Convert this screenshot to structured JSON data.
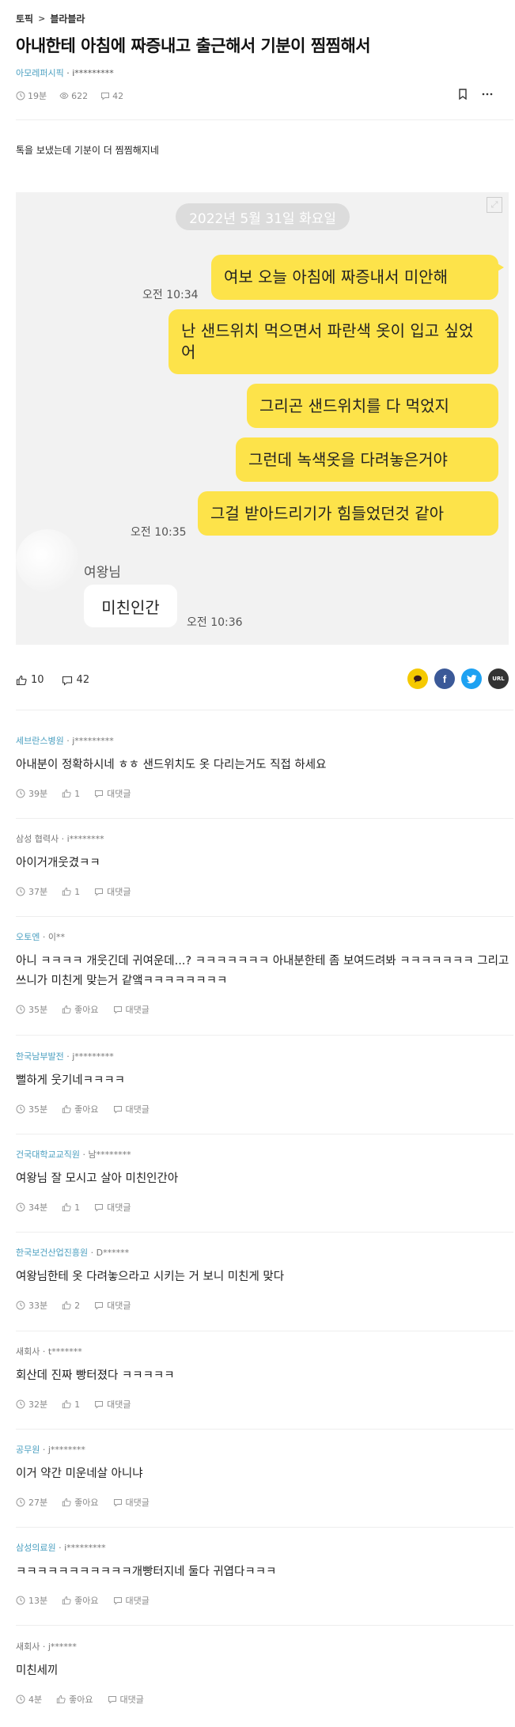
{
  "breadcrumb": {
    "section": "토픽",
    "separator": ">",
    "board": "블라블라"
  },
  "post": {
    "title": "아내한테 아침에 짜증내고 출근해서 기분이 찜찜해서",
    "company": "아모레퍼시픽",
    "separator": " · ",
    "nickname": "i*********",
    "time": "19분",
    "views": "622",
    "comments": "42",
    "body": "톡을 보냈는데 기분이 더 찜찜해지네"
  },
  "chat": {
    "date": "2022년 5월 31일 화요일",
    "messages": [
      "여보 오늘 아침에 짜증내서 미안해",
      "난 샌드위치 먹으면서 파란색 옷이 입고 싶었어",
      "그리곤 샌드위치를 다 먹었지",
      "그런데 녹색옷을 다려놓은거야",
      "그걸 받아드리기가 힘들었던것 같아"
    ],
    "time_first": "오전 10:34",
    "time_last": "오전 10:35",
    "sender": "여왕님",
    "reply": "미친인간",
    "reply_time": "오전 10:36"
  },
  "stats": {
    "likes": "10",
    "comments": "42"
  },
  "share": {
    "url_label": "URL"
  },
  "comments": [
    {
      "company": "세브란스병원",
      "nick": "j*********",
      "text": "아내분이 정확하시네 ㅎㅎ 샌드위치도 옷 다리는거도 직접 하세요",
      "time": "39분",
      "likes": "1",
      "reply": "대댓글"
    },
    {
      "company": "삼성 협력사",
      "nick": "i********",
      "text": "아이거개웃겼ㅋㅋ",
      "time": "37분",
      "likes": "1",
      "reply": "대댓글"
    },
    {
      "company": "오토엔",
      "nick": "이**",
      "text": "아니 ㅋㅋㅋㅋ 개웃긴데 귀여운데...? ㅋㅋㅋㅋㅋㅋㅋ 아내분한테 좀 보여드려봐 ㅋㅋㅋㅋㅋㅋㅋ 그리고 쓰니가 미친게 맞는거 같앸ㅋㅋㅋㅋㅋㅋㅋㅋ",
      "time": "35분",
      "likes": "좋아요",
      "reply": "대댓글"
    },
    {
      "company": "한국남부발전",
      "nick": "j*********",
      "text": "뻘하게 웃기네ㅋㅋㅋㅋ",
      "time": "35분",
      "likes": "좋아요",
      "reply": "대댓글"
    },
    {
      "company": "건국대학교교직원",
      "nick": "남********",
      "text": "여왕님 잘 모시고 살아 미친인간아",
      "time": "34분",
      "likes": "1",
      "reply": "대댓글"
    },
    {
      "company": "한국보건산업진흥원",
      "nick": "D******",
      "text": "여왕님한테 옷 다려놓으라고 시키는 거 보니 미친게 맞다",
      "time": "33분",
      "likes": "2",
      "reply": "대댓글"
    },
    {
      "company": "새회사",
      "nick": "t*******",
      "text": "회산데 진짜 빵터졌다 ㅋㅋㅋㅋㅋ",
      "time": "32분",
      "likes": "1",
      "reply": "대댓글"
    },
    {
      "company": "공무원",
      "nick": "j********",
      "text": "이거 약간 미운네살 아니냐",
      "time": "27분",
      "likes": "좋아요",
      "reply": "대댓글"
    },
    {
      "company": "삼성의료원",
      "nick": "i*********",
      "text": "ㅋㅋㅋㅋㅋㅋㅋㅋㅋㅋㅋ개빵터지네 둘다 귀엽다ㅋㅋㅋ",
      "time": "13분",
      "likes": "좋아요",
      "reply": "대댓글"
    },
    {
      "company": "새회사",
      "nick": "j******",
      "text": "미친세끼",
      "time": "4분",
      "likes": "좋아요",
      "reply": "대댓글"
    }
  ],
  "colors": {
    "company": "#4a9fc0",
    "bubble_yellow": "#fde34a",
    "kakao": "#f5c900",
    "facebook": "#3b5998",
    "twitter": "#1da1f2",
    "url": "#333333"
  },
  "icons": [
    "clock-icon",
    "eye-icon",
    "speech-bubble-icon",
    "bookmark-icon",
    "more-icon",
    "expand-icon",
    "thumbs-up-icon",
    "kakao-icon",
    "facebook-icon",
    "twitter-icon"
  ]
}
